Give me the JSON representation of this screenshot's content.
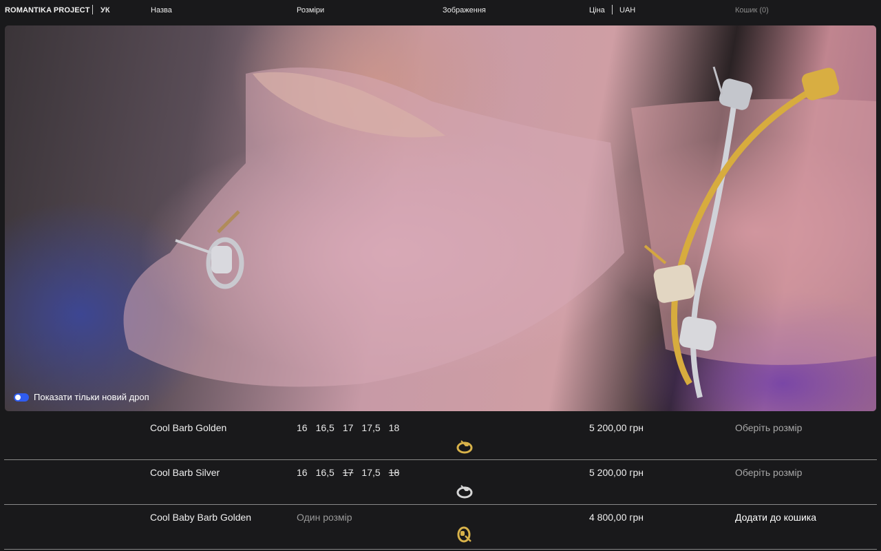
{
  "header": {
    "brand": "ROMANTIKA PROJECT",
    "lang": "УК",
    "col_name": "Назва",
    "col_sizes": "Розміри",
    "col_image": "Зображення",
    "col_price": "Ціна",
    "currency": "UAH",
    "cart": "Кошик (0)"
  },
  "hero": {
    "toggle_label": "Показати тільки новий дроп",
    "toggle_on": true
  },
  "products": [
    {
      "name": "Cool Barb Golden",
      "sizes": [
        {
          "label": "16",
          "available": true
        },
        {
          "label": "16,5",
          "available": true
        },
        {
          "label": "17",
          "available": true
        },
        {
          "label": "17,5",
          "available": true
        },
        {
          "label": "18",
          "available": true
        }
      ],
      "price": "5 200,00 грн",
      "action": "Оберіть розмір",
      "thumb": "gold-ring-icon",
      "color": "#d8b24a"
    },
    {
      "name": "Cool Barb Silver",
      "sizes": [
        {
          "label": "16",
          "available": true
        },
        {
          "label": "16,5",
          "available": true
        },
        {
          "label": "17",
          "available": false
        },
        {
          "label": "17,5",
          "available": true
        },
        {
          "label": "18",
          "available": false
        }
      ],
      "price": "5 200,00 грн",
      "action": "Оберіть розмір",
      "thumb": "silver-ring-icon",
      "color": "#d6d6d6"
    },
    {
      "name": "Cool Baby Barb Golden",
      "one_size": "Один розмір",
      "price": "4 800,00 грн",
      "action": "Додати до кошика",
      "thumb": "gold-earring-icon",
      "color": "#d8b24a"
    }
  ]
}
